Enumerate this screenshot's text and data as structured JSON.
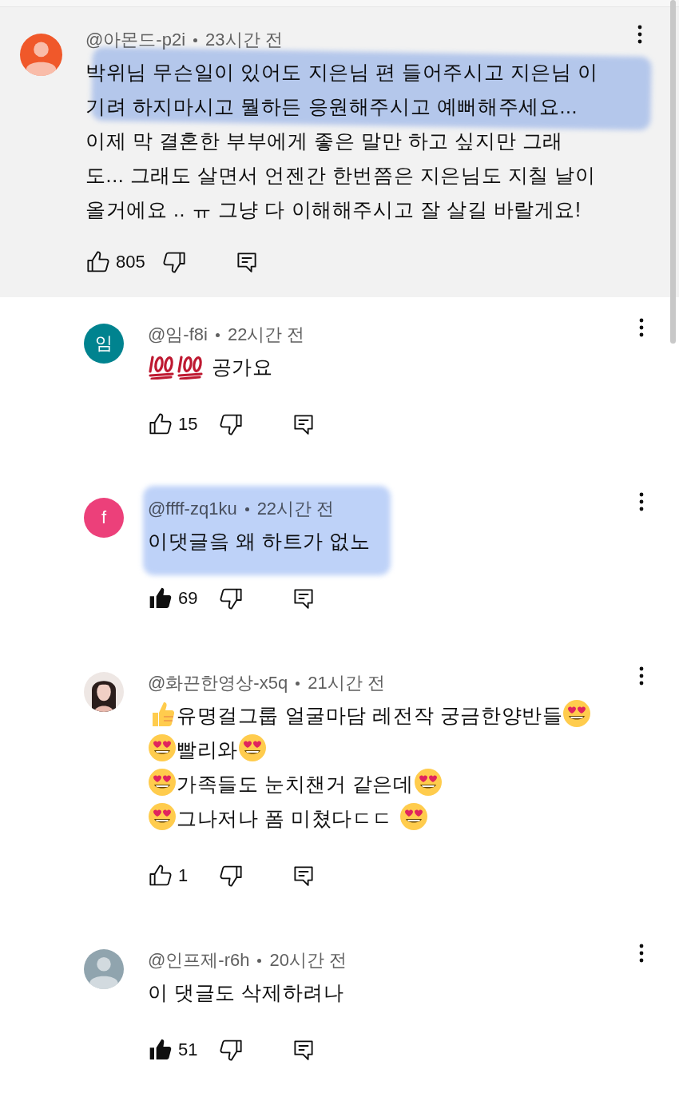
{
  "comments": [
    {
      "author": "@아몬드-p2i",
      "time": "23시간 전",
      "selected": true,
      "highlighted": true,
      "liked": false,
      "likes": "805",
      "avatar": {
        "kind": "silhouette",
        "color": "#f0582a"
      },
      "lines": [
        [
          {
            "kind": "text",
            "text": "박위님 무슨일이 있어도 지은님 편 들어주시고 지은님 이기려 하지마시고 뭘하든 응원해주시고 예뻐해주세요... 이제 막 결혼한 부부에게 좋은 말만 하고 싶지만 그래도... 그래도 살면서 언젠간 한번쯤은 지은님도 지칠 날이 올거에요 .. ㅠ 그냥 다 이해해주시고 잘 살길 바랄게요!"
          }
        ]
      ],
      "replies": [
        {
          "author": "@임-f8i",
          "time": "22시간 전",
          "selected": false,
          "highlighted": false,
          "liked": false,
          "likes": "15",
          "avatar": {
            "kind": "letter",
            "text": "임",
            "color": "#00838f"
          },
          "lines": [
            [
              {
                "kind": "hundred"
              },
              {
                "kind": "hundred"
              },
              {
                "kind": "text",
                "text": " 공가요"
              }
            ]
          ]
        },
        {
          "author": "@ffff-zq1ku",
          "time": "22시간 전",
          "selected": false,
          "highlighted": true,
          "liked": true,
          "likes": "69",
          "avatar": {
            "kind": "letter",
            "text": "f",
            "color": "#ec407a"
          },
          "lines": [
            [
              {
                "kind": "text",
                "text": "이댓글읔 왜 하트가 없노"
              }
            ]
          ]
        },
        {
          "author": "@화끈한영상-x5q",
          "time": "21시간 전",
          "selected": false,
          "highlighted": false,
          "liked": false,
          "likes": "1",
          "avatar": {
            "kind": "picture"
          },
          "lines": [
            [
              {
                "kind": "thumbs_up"
              },
              {
                "kind": "text",
                "text": "유명걸그룹 얼굴마담 레전작 궁금한양반들"
              },
              {
                "kind": "heart_eyes"
              }
            ],
            [
              {
                "kind": "heart_eyes"
              },
              {
                "kind": "text",
                "text": "빨리와"
              },
              {
                "kind": "heart_eyes"
              }
            ],
            [
              {
                "kind": "heart_eyes"
              },
              {
                "kind": "text",
                "text": "가족들도 눈치챈거 같은데"
              },
              {
                "kind": "heart_eyes"
              }
            ],
            [
              {
                "kind": "heart_eyes"
              },
              {
                "kind": "text",
                "text": "그나저나 폼 미쳤다ㄷㄷ "
              },
              {
                "kind": "heart_eyes"
              }
            ]
          ]
        },
        {
          "author": "@인프제-r6h",
          "time": "20시간 전",
          "selected": false,
          "highlighted": false,
          "liked": true,
          "likes": "51",
          "avatar": {
            "kind": "silhouette",
            "color": "#90a4ae"
          },
          "lines": [
            [
              {
                "kind": "text",
                "text": "이 댓글도 삭제하려나"
              }
            ]
          ]
        }
      ]
    }
  ]
}
